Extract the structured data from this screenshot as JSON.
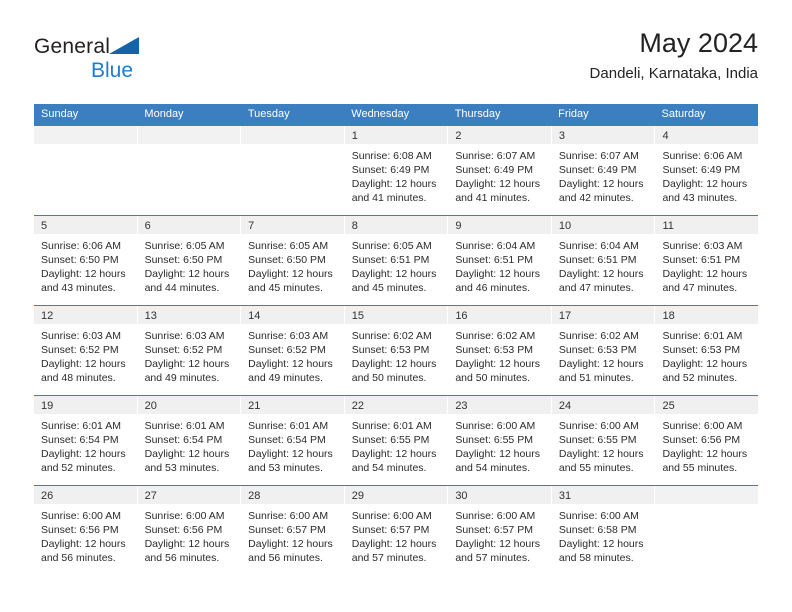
{
  "brand": {
    "name_part1": "General",
    "name_part2": "Blue",
    "triangle_color": "#1464aa",
    "blue_color": "#1d7dd4"
  },
  "header": {
    "title": "May 2024",
    "subtitle": "Dandeli, Karnataka, India"
  },
  "theme": {
    "header_blue": "#3c7fc1",
    "daynum_band": "#f0f0f0",
    "text": "#2b2b2b"
  },
  "weekday_headers": [
    "Sunday",
    "Monday",
    "Tuesday",
    "Wednesday",
    "Thursday",
    "Friday",
    "Saturday"
  ],
  "labels": {
    "sunrise_prefix": "Sunrise:",
    "sunset_prefix": "Sunset:",
    "daylight_prefix": "Daylight:"
  },
  "weeks": [
    [
      {
        "day": "",
        "sunrise": "",
        "sunset": "",
        "daylight_line1": "",
        "daylight_line2": ""
      },
      {
        "day": "",
        "sunrise": "",
        "sunset": "",
        "daylight_line1": "",
        "daylight_line2": ""
      },
      {
        "day": "",
        "sunrise": "",
        "sunset": "",
        "daylight_line1": "",
        "daylight_line2": ""
      },
      {
        "day": "1",
        "sunrise": "Sunrise: 6:08 AM",
        "sunset": "Sunset: 6:49 PM",
        "daylight_line1": "Daylight: 12 hours",
        "daylight_line2": "and 41 minutes."
      },
      {
        "day": "2",
        "sunrise": "Sunrise: 6:07 AM",
        "sunset": "Sunset: 6:49 PM",
        "daylight_line1": "Daylight: 12 hours",
        "daylight_line2": "and 41 minutes."
      },
      {
        "day": "3",
        "sunrise": "Sunrise: 6:07 AM",
        "sunset": "Sunset: 6:49 PM",
        "daylight_line1": "Daylight: 12 hours",
        "daylight_line2": "and 42 minutes."
      },
      {
        "day": "4",
        "sunrise": "Sunrise: 6:06 AM",
        "sunset": "Sunset: 6:49 PM",
        "daylight_line1": "Daylight: 12 hours",
        "daylight_line2": "and 43 minutes."
      }
    ],
    [
      {
        "day": "5",
        "sunrise": "Sunrise: 6:06 AM",
        "sunset": "Sunset: 6:50 PM",
        "daylight_line1": "Daylight: 12 hours",
        "daylight_line2": "and 43 minutes."
      },
      {
        "day": "6",
        "sunrise": "Sunrise: 6:05 AM",
        "sunset": "Sunset: 6:50 PM",
        "daylight_line1": "Daylight: 12 hours",
        "daylight_line2": "and 44 minutes."
      },
      {
        "day": "7",
        "sunrise": "Sunrise: 6:05 AM",
        "sunset": "Sunset: 6:50 PM",
        "daylight_line1": "Daylight: 12 hours",
        "daylight_line2": "and 45 minutes."
      },
      {
        "day": "8",
        "sunrise": "Sunrise: 6:05 AM",
        "sunset": "Sunset: 6:51 PM",
        "daylight_line1": "Daylight: 12 hours",
        "daylight_line2": "and 45 minutes."
      },
      {
        "day": "9",
        "sunrise": "Sunrise: 6:04 AM",
        "sunset": "Sunset: 6:51 PM",
        "daylight_line1": "Daylight: 12 hours",
        "daylight_line2": "and 46 minutes."
      },
      {
        "day": "10",
        "sunrise": "Sunrise: 6:04 AM",
        "sunset": "Sunset: 6:51 PM",
        "daylight_line1": "Daylight: 12 hours",
        "daylight_line2": "and 47 minutes."
      },
      {
        "day": "11",
        "sunrise": "Sunrise: 6:03 AM",
        "sunset": "Sunset: 6:51 PM",
        "daylight_line1": "Daylight: 12 hours",
        "daylight_line2": "and 47 minutes."
      }
    ],
    [
      {
        "day": "12",
        "sunrise": "Sunrise: 6:03 AM",
        "sunset": "Sunset: 6:52 PM",
        "daylight_line1": "Daylight: 12 hours",
        "daylight_line2": "and 48 minutes."
      },
      {
        "day": "13",
        "sunrise": "Sunrise: 6:03 AM",
        "sunset": "Sunset: 6:52 PM",
        "daylight_line1": "Daylight: 12 hours",
        "daylight_line2": "and 49 minutes."
      },
      {
        "day": "14",
        "sunrise": "Sunrise: 6:03 AM",
        "sunset": "Sunset: 6:52 PM",
        "daylight_line1": "Daylight: 12 hours",
        "daylight_line2": "and 49 minutes."
      },
      {
        "day": "15",
        "sunrise": "Sunrise: 6:02 AM",
        "sunset": "Sunset: 6:53 PM",
        "daylight_line1": "Daylight: 12 hours",
        "daylight_line2": "and 50 minutes."
      },
      {
        "day": "16",
        "sunrise": "Sunrise: 6:02 AM",
        "sunset": "Sunset: 6:53 PM",
        "daylight_line1": "Daylight: 12 hours",
        "daylight_line2": "and 50 minutes."
      },
      {
        "day": "17",
        "sunrise": "Sunrise: 6:02 AM",
        "sunset": "Sunset: 6:53 PM",
        "daylight_line1": "Daylight: 12 hours",
        "daylight_line2": "and 51 minutes."
      },
      {
        "day": "18",
        "sunrise": "Sunrise: 6:01 AM",
        "sunset": "Sunset: 6:53 PM",
        "daylight_line1": "Daylight: 12 hours",
        "daylight_line2": "and 52 minutes."
      }
    ],
    [
      {
        "day": "19",
        "sunrise": "Sunrise: 6:01 AM",
        "sunset": "Sunset: 6:54 PM",
        "daylight_line1": "Daylight: 12 hours",
        "daylight_line2": "and 52 minutes."
      },
      {
        "day": "20",
        "sunrise": "Sunrise: 6:01 AM",
        "sunset": "Sunset: 6:54 PM",
        "daylight_line1": "Daylight: 12 hours",
        "daylight_line2": "and 53 minutes."
      },
      {
        "day": "21",
        "sunrise": "Sunrise: 6:01 AM",
        "sunset": "Sunset: 6:54 PM",
        "daylight_line1": "Daylight: 12 hours",
        "daylight_line2": "and 53 minutes."
      },
      {
        "day": "22",
        "sunrise": "Sunrise: 6:01 AM",
        "sunset": "Sunset: 6:55 PM",
        "daylight_line1": "Daylight: 12 hours",
        "daylight_line2": "and 54 minutes."
      },
      {
        "day": "23",
        "sunrise": "Sunrise: 6:00 AM",
        "sunset": "Sunset: 6:55 PM",
        "daylight_line1": "Daylight: 12 hours",
        "daylight_line2": "and 54 minutes."
      },
      {
        "day": "24",
        "sunrise": "Sunrise: 6:00 AM",
        "sunset": "Sunset: 6:55 PM",
        "daylight_line1": "Daylight: 12 hours",
        "daylight_line2": "and 55 minutes."
      },
      {
        "day": "25",
        "sunrise": "Sunrise: 6:00 AM",
        "sunset": "Sunset: 6:56 PM",
        "daylight_line1": "Daylight: 12 hours",
        "daylight_line2": "and 55 minutes."
      }
    ],
    [
      {
        "day": "26",
        "sunrise": "Sunrise: 6:00 AM",
        "sunset": "Sunset: 6:56 PM",
        "daylight_line1": "Daylight: 12 hours",
        "daylight_line2": "and 56 minutes."
      },
      {
        "day": "27",
        "sunrise": "Sunrise: 6:00 AM",
        "sunset": "Sunset: 6:56 PM",
        "daylight_line1": "Daylight: 12 hours",
        "daylight_line2": "and 56 minutes."
      },
      {
        "day": "28",
        "sunrise": "Sunrise: 6:00 AM",
        "sunset": "Sunset: 6:57 PM",
        "daylight_line1": "Daylight: 12 hours",
        "daylight_line2": "and 56 minutes."
      },
      {
        "day": "29",
        "sunrise": "Sunrise: 6:00 AM",
        "sunset": "Sunset: 6:57 PM",
        "daylight_line1": "Daylight: 12 hours",
        "daylight_line2": "and 57 minutes."
      },
      {
        "day": "30",
        "sunrise": "Sunrise: 6:00 AM",
        "sunset": "Sunset: 6:57 PM",
        "daylight_line1": "Daylight: 12 hours",
        "daylight_line2": "and 57 minutes."
      },
      {
        "day": "31",
        "sunrise": "Sunrise: 6:00 AM",
        "sunset": "Sunset: 6:58 PM",
        "daylight_line1": "Daylight: 12 hours",
        "daylight_line2": "and 58 minutes."
      },
      {
        "day": "",
        "sunrise": "",
        "sunset": "",
        "daylight_line1": "",
        "daylight_line2": ""
      }
    ]
  ]
}
